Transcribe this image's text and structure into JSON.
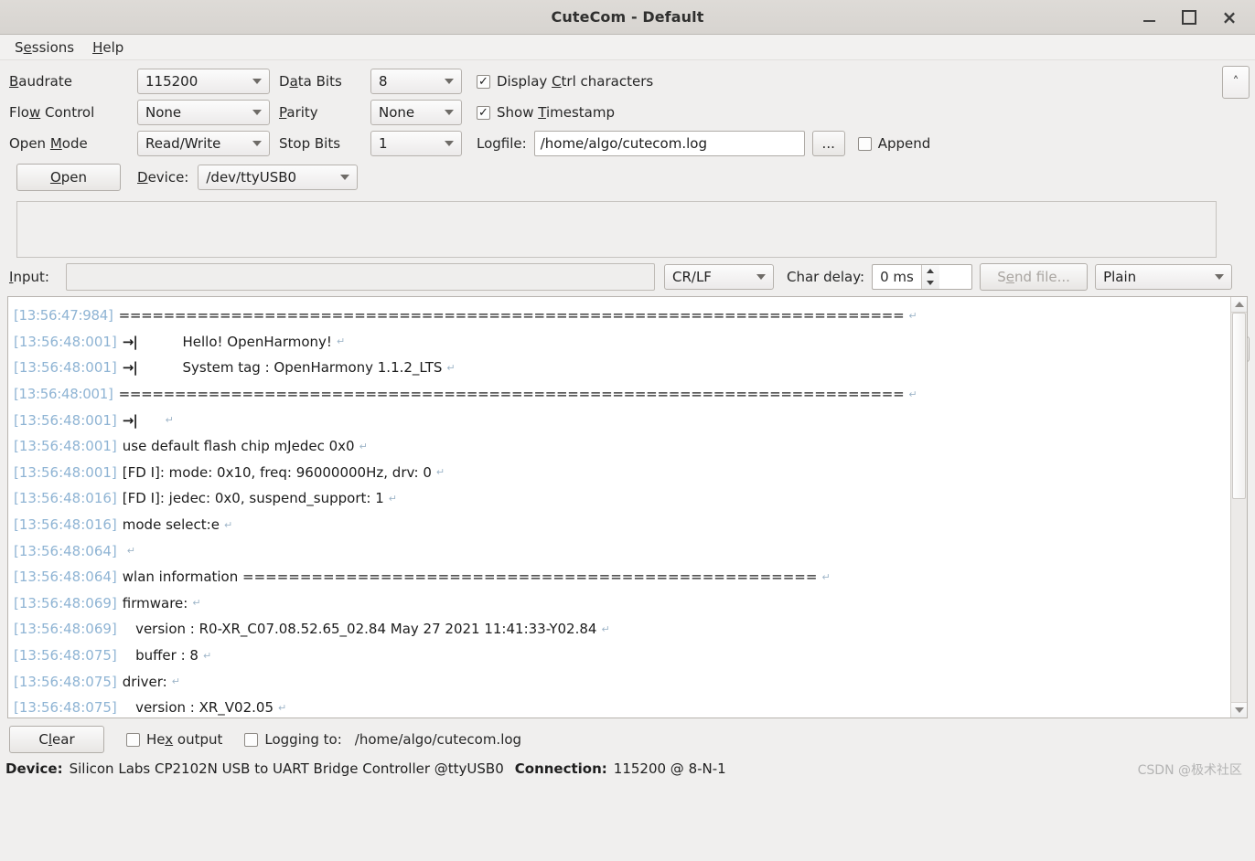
{
  "window": {
    "title": "CuteCom - Default",
    "minimize_icon": "minimize-icon",
    "maximize_icon": "maximize-icon",
    "close_icon": "close-icon",
    "close_glyph": "×"
  },
  "menubar": {
    "items": [
      {
        "pre": "S",
        "accel": "e",
        "post": "ssions"
      },
      {
        "pre": "",
        "accel": "H",
        "post": "elp"
      }
    ]
  },
  "settings": {
    "baudrate": {
      "pre": "",
      "accel": "B",
      "post": "audrate",
      "value": "115200"
    },
    "data_bits": {
      "pre": "D",
      "accel": "a",
      "post": "ta Bits",
      "value": "8"
    },
    "display_ctrl": {
      "pre": "Display ",
      "accel": "C",
      "post": "trl characters",
      "checked": true
    },
    "flow_control": {
      "pre": "Flo",
      "accel": "w",
      "post": " Control",
      "value": "None"
    },
    "parity": {
      "pre": "",
      "accel": "P",
      "post": "arity",
      "value": "None"
    },
    "show_timestamp": {
      "pre": "Show ",
      "accel": "T",
      "post": "imestamp",
      "checked": true
    },
    "open_mode": {
      "pre": "Open ",
      "accel": "M",
      "post": "ode",
      "value": "Read/Write"
    },
    "stop_bits": {
      "label": "Stop Bits",
      "value": "1"
    },
    "logfile": {
      "label": "Logfile:",
      "value": "/home/algo/cutecom.log"
    },
    "browse_button": "...",
    "append": {
      "label": "Append",
      "checked": false
    },
    "open_button": {
      "pre": "",
      "accel": "O",
      "post": "pen"
    },
    "device": {
      "pre": "",
      "accel": "D",
      "post": "evice:",
      "value": "/dev/ttyUSB0"
    },
    "scroll_up_glyph": "˄"
  },
  "input_row": {
    "label": {
      "pre": "",
      "accel": "I",
      "post": "nput:"
    },
    "value": "",
    "placeholder": "",
    "line_end": "CR/LF",
    "char_delay_label": "Char delay:",
    "char_delay_value": "0 ms",
    "send_file": {
      "pre": "S",
      "accel": "e",
      "post": "nd file..."
    },
    "format": "Plain"
  },
  "terminal": {
    "tab_glyph": "→|",
    "cr_glyph": "↵",
    "separator": "======================================================================",
    "wlan_separator": "==================================================",
    "lines": [
      {
        "ts": "[13:56:47:984]",
        "kind": "sep",
        "text": "======================================================================",
        "cr": true
      },
      {
        "ts": "[13:56:48:001]",
        "kind": "tab",
        "indent": "          ",
        "text": "Hello! OpenHarmony!",
        "cr": true
      },
      {
        "ts": "[13:56:48:001]",
        "kind": "tab",
        "indent": "          ",
        "text": "System tag : OpenHarmony 1.1.2_LTS",
        "cr": true
      },
      {
        "ts": "[13:56:48:001]",
        "kind": "sep",
        "text": "======================================================================",
        "cr": true
      },
      {
        "ts": "[13:56:48:001]",
        "kind": "tab",
        "indent": "     ",
        "text": "",
        "cr": true
      },
      {
        "ts": "[13:56:48:001]",
        "kind": "text",
        "text": "use default flash chip mJedec 0x0",
        "cr": true
      },
      {
        "ts": "[13:56:48:001]",
        "kind": "text",
        "text": "[FD I]: mode: 0x10, freq: 96000000Hz, drv: 0",
        "cr": true
      },
      {
        "ts": "[13:56:48:016]",
        "kind": "text",
        "text": "[FD I]: jedec: 0x0, suspend_support: 1",
        "cr": true
      },
      {
        "ts": "[13:56:48:016]",
        "kind": "text",
        "text": "mode select:e",
        "cr": true
      },
      {
        "ts": "[13:56:48:064]",
        "kind": "text",
        "text": "",
        "cr": true
      },
      {
        "ts": "[13:56:48:064]",
        "kind": "text",
        "text": "wlan information ==================================================",
        "cr": true
      },
      {
        "ts": "[13:56:48:069]",
        "kind": "text",
        "text": "firmware:",
        "cr": true
      },
      {
        "ts": "[13:56:48:069]",
        "kind": "text",
        "text": "   version : R0-XR_C07.08.52.65_02.84 May 27 2021 11:41:33-Y02.84",
        "cr": true
      },
      {
        "ts": "[13:56:48:075]",
        "kind": "text",
        "text": "   buffer : 8",
        "cr": true
      },
      {
        "ts": "[13:56:48:075]",
        "kind": "text",
        "text": "driver:",
        "cr": true
      },
      {
        "ts": "[13:56:48:075]",
        "kind": "text",
        "text": "   version : XR_V02.05",
        "cr": true
      }
    ]
  },
  "bottom": {
    "clear_button": {
      "pre": "C",
      "accel": "l",
      "post": "ear"
    },
    "hex_output": {
      "pre": "He",
      "accel": "x",
      "post": " output",
      "checked": false
    },
    "logging_to": {
      "label": "Logging to:",
      "checked": false,
      "path": "/home/algo/cutecom.log"
    }
  },
  "status": {
    "device_label": "Device:",
    "device_value": "Silicon Labs CP2102N USB to UART Bridge Controller @ttyUSB0",
    "connection_label": "Connection:",
    "connection_value": "115200 @ 8-N-1",
    "watermark": "CSDN @极术社区"
  }
}
